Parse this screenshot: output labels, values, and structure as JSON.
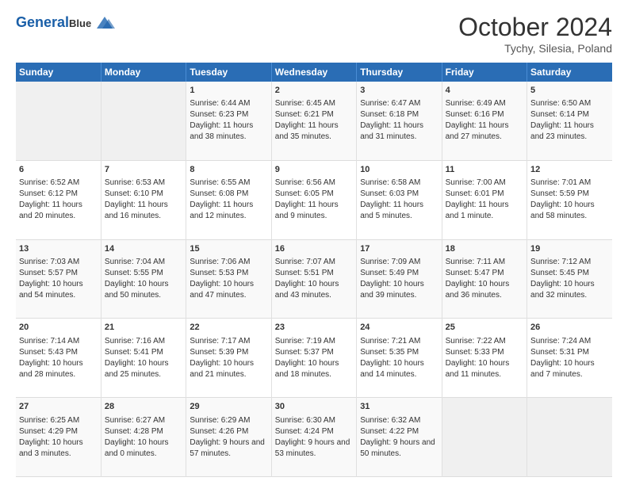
{
  "header": {
    "logo_line1": "General",
    "logo_line2": "Blue",
    "title": "October 2024",
    "subtitle": "Tychy, Silesia, Poland"
  },
  "weekdays": [
    "Sunday",
    "Monday",
    "Tuesday",
    "Wednesday",
    "Thursday",
    "Friday",
    "Saturday"
  ],
  "weeks": [
    [
      {
        "day": "",
        "sunrise": "",
        "sunset": "",
        "daylight": "",
        "empty": true
      },
      {
        "day": "",
        "sunrise": "",
        "sunset": "",
        "daylight": "",
        "empty": true
      },
      {
        "day": "1",
        "sunrise": "Sunrise: 6:44 AM",
        "sunset": "Sunset: 6:23 PM",
        "daylight": "Daylight: 11 hours and 38 minutes.",
        "empty": false
      },
      {
        "day": "2",
        "sunrise": "Sunrise: 6:45 AM",
        "sunset": "Sunset: 6:21 PM",
        "daylight": "Daylight: 11 hours and 35 minutes.",
        "empty": false
      },
      {
        "day": "3",
        "sunrise": "Sunrise: 6:47 AM",
        "sunset": "Sunset: 6:18 PM",
        "daylight": "Daylight: 11 hours and 31 minutes.",
        "empty": false
      },
      {
        "day": "4",
        "sunrise": "Sunrise: 6:49 AM",
        "sunset": "Sunset: 6:16 PM",
        "daylight": "Daylight: 11 hours and 27 minutes.",
        "empty": false
      },
      {
        "day": "5",
        "sunrise": "Sunrise: 6:50 AM",
        "sunset": "Sunset: 6:14 PM",
        "daylight": "Daylight: 11 hours and 23 minutes.",
        "empty": false
      }
    ],
    [
      {
        "day": "6",
        "sunrise": "Sunrise: 6:52 AM",
        "sunset": "Sunset: 6:12 PM",
        "daylight": "Daylight: 11 hours and 20 minutes.",
        "empty": false
      },
      {
        "day": "7",
        "sunrise": "Sunrise: 6:53 AM",
        "sunset": "Sunset: 6:10 PM",
        "daylight": "Daylight: 11 hours and 16 minutes.",
        "empty": false
      },
      {
        "day": "8",
        "sunrise": "Sunrise: 6:55 AM",
        "sunset": "Sunset: 6:08 PM",
        "daylight": "Daylight: 11 hours and 12 minutes.",
        "empty": false
      },
      {
        "day": "9",
        "sunrise": "Sunrise: 6:56 AM",
        "sunset": "Sunset: 6:05 PM",
        "daylight": "Daylight: 11 hours and 9 minutes.",
        "empty": false
      },
      {
        "day": "10",
        "sunrise": "Sunrise: 6:58 AM",
        "sunset": "Sunset: 6:03 PM",
        "daylight": "Daylight: 11 hours and 5 minutes.",
        "empty": false
      },
      {
        "day": "11",
        "sunrise": "Sunrise: 7:00 AM",
        "sunset": "Sunset: 6:01 PM",
        "daylight": "Daylight: 11 hours and 1 minute.",
        "empty": false
      },
      {
        "day": "12",
        "sunrise": "Sunrise: 7:01 AM",
        "sunset": "Sunset: 5:59 PM",
        "daylight": "Daylight: 10 hours and 58 minutes.",
        "empty": false
      }
    ],
    [
      {
        "day": "13",
        "sunrise": "Sunrise: 7:03 AM",
        "sunset": "Sunset: 5:57 PM",
        "daylight": "Daylight: 10 hours and 54 minutes.",
        "empty": false
      },
      {
        "day": "14",
        "sunrise": "Sunrise: 7:04 AM",
        "sunset": "Sunset: 5:55 PM",
        "daylight": "Daylight: 10 hours and 50 minutes.",
        "empty": false
      },
      {
        "day": "15",
        "sunrise": "Sunrise: 7:06 AM",
        "sunset": "Sunset: 5:53 PM",
        "daylight": "Daylight: 10 hours and 47 minutes.",
        "empty": false
      },
      {
        "day": "16",
        "sunrise": "Sunrise: 7:07 AM",
        "sunset": "Sunset: 5:51 PM",
        "daylight": "Daylight: 10 hours and 43 minutes.",
        "empty": false
      },
      {
        "day": "17",
        "sunrise": "Sunrise: 7:09 AM",
        "sunset": "Sunset: 5:49 PM",
        "daylight": "Daylight: 10 hours and 39 minutes.",
        "empty": false
      },
      {
        "day": "18",
        "sunrise": "Sunrise: 7:11 AM",
        "sunset": "Sunset: 5:47 PM",
        "daylight": "Daylight: 10 hours and 36 minutes.",
        "empty": false
      },
      {
        "day": "19",
        "sunrise": "Sunrise: 7:12 AM",
        "sunset": "Sunset: 5:45 PM",
        "daylight": "Daylight: 10 hours and 32 minutes.",
        "empty": false
      }
    ],
    [
      {
        "day": "20",
        "sunrise": "Sunrise: 7:14 AM",
        "sunset": "Sunset: 5:43 PM",
        "daylight": "Daylight: 10 hours and 28 minutes.",
        "empty": false
      },
      {
        "day": "21",
        "sunrise": "Sunrise: 7:16 AM",
        "sunset": "Sunset: 5:41 PM",
        "daylight": "Daylight: 10 hours and 25 minutes.",
        "empty": false
      },
      {
        "day": "22",
        "sunrise": "Sunrise: 7:17 AM",
        "sunset": "Sunset: 5:39 PM",
        "daylight": "Daylight: 10 hours and 21 minutes.",
        "empty": false
      },
      {
        "day": "23",
        "sunrise": "Sunrise: 7:19 AM",
        "sunset": "Sunset: 5:37 PM",
        "daylight": "Daylight: 10 hours and 18 minutes.",
        "empty": false
      },
      {
        "day": "24",
        "sunrise": "Sunrise: 7:21 AM",
        "sunset": "Sunset: 5:35 PM",
        "daylight": "Daylight: 10 hours and 14 minutes.",
        "empty": false
      },
      {
        "day": "25",
        "sunrise": "Sunrise: 7:22 AM",
        "sunset": "Sunset: 5:33 PM",
        "daylight": "Daylight: 10 hours and 11 minutes.",
        "empty": false
      },
      {
        "day": "26",
        "sunrise": "Sunrise: 7:24 AM",
        "sunset": "Sunset: 5:31 PM",
        "daylight": "Daylight: 10 hours and 7 minutes.",
        "empty": false
      }
    ],
    [
      {
        "day": "27",
        "sunrise": "Sunrise: 6:25 AM",
        "sunset": "Sunset: 4:29 PM",
        "daylight": "Daylight: 10 hours and 3 minutes.",
        "empty": false
      },
      {
        "day": "28",
        "sunrise": "Sunrise: 6:27 AM",
        "sunset": "Sunset: 4:28 PM",
        "daylight": "Daylight: 10 hours and 0 minutes.",
        "empty": false
      },
      {
        "day": "29",
        "sunrise": "Sunrise: 6:29 AM",
        "sunset": "Sunset: 4:26 PM",
        "daylight": "Daylight: 9 hours and 57 minutes.",
        "empty": false
      },
      {
        "day": "30",
        "sunrise": "Sunrise: 6:30 AM",
        "sunset": "Sunset: 4:24 PM",
        "daylight": "Daylight: 9 hours and 53 minutes.",
        "empty": false
      },
      {
        "day": "31",
        "sunrise": "Sunrise: 6:32 AM",
        "sunset": "Sunset: 4:22 PM",
        "daylight": "Daylight: 9 hours and 50 minutes.",
        "empty": false
      },
      {
        "day": "",
        "sunrise": "",
        "sunset": "",
        "daylight": "",
        "empty": true
      },
      {
        "day": "",
        "sunrise": "",
        "sunset": "",
        "daylight": "",
        "empty": true
      }
    ]
  ]
}
